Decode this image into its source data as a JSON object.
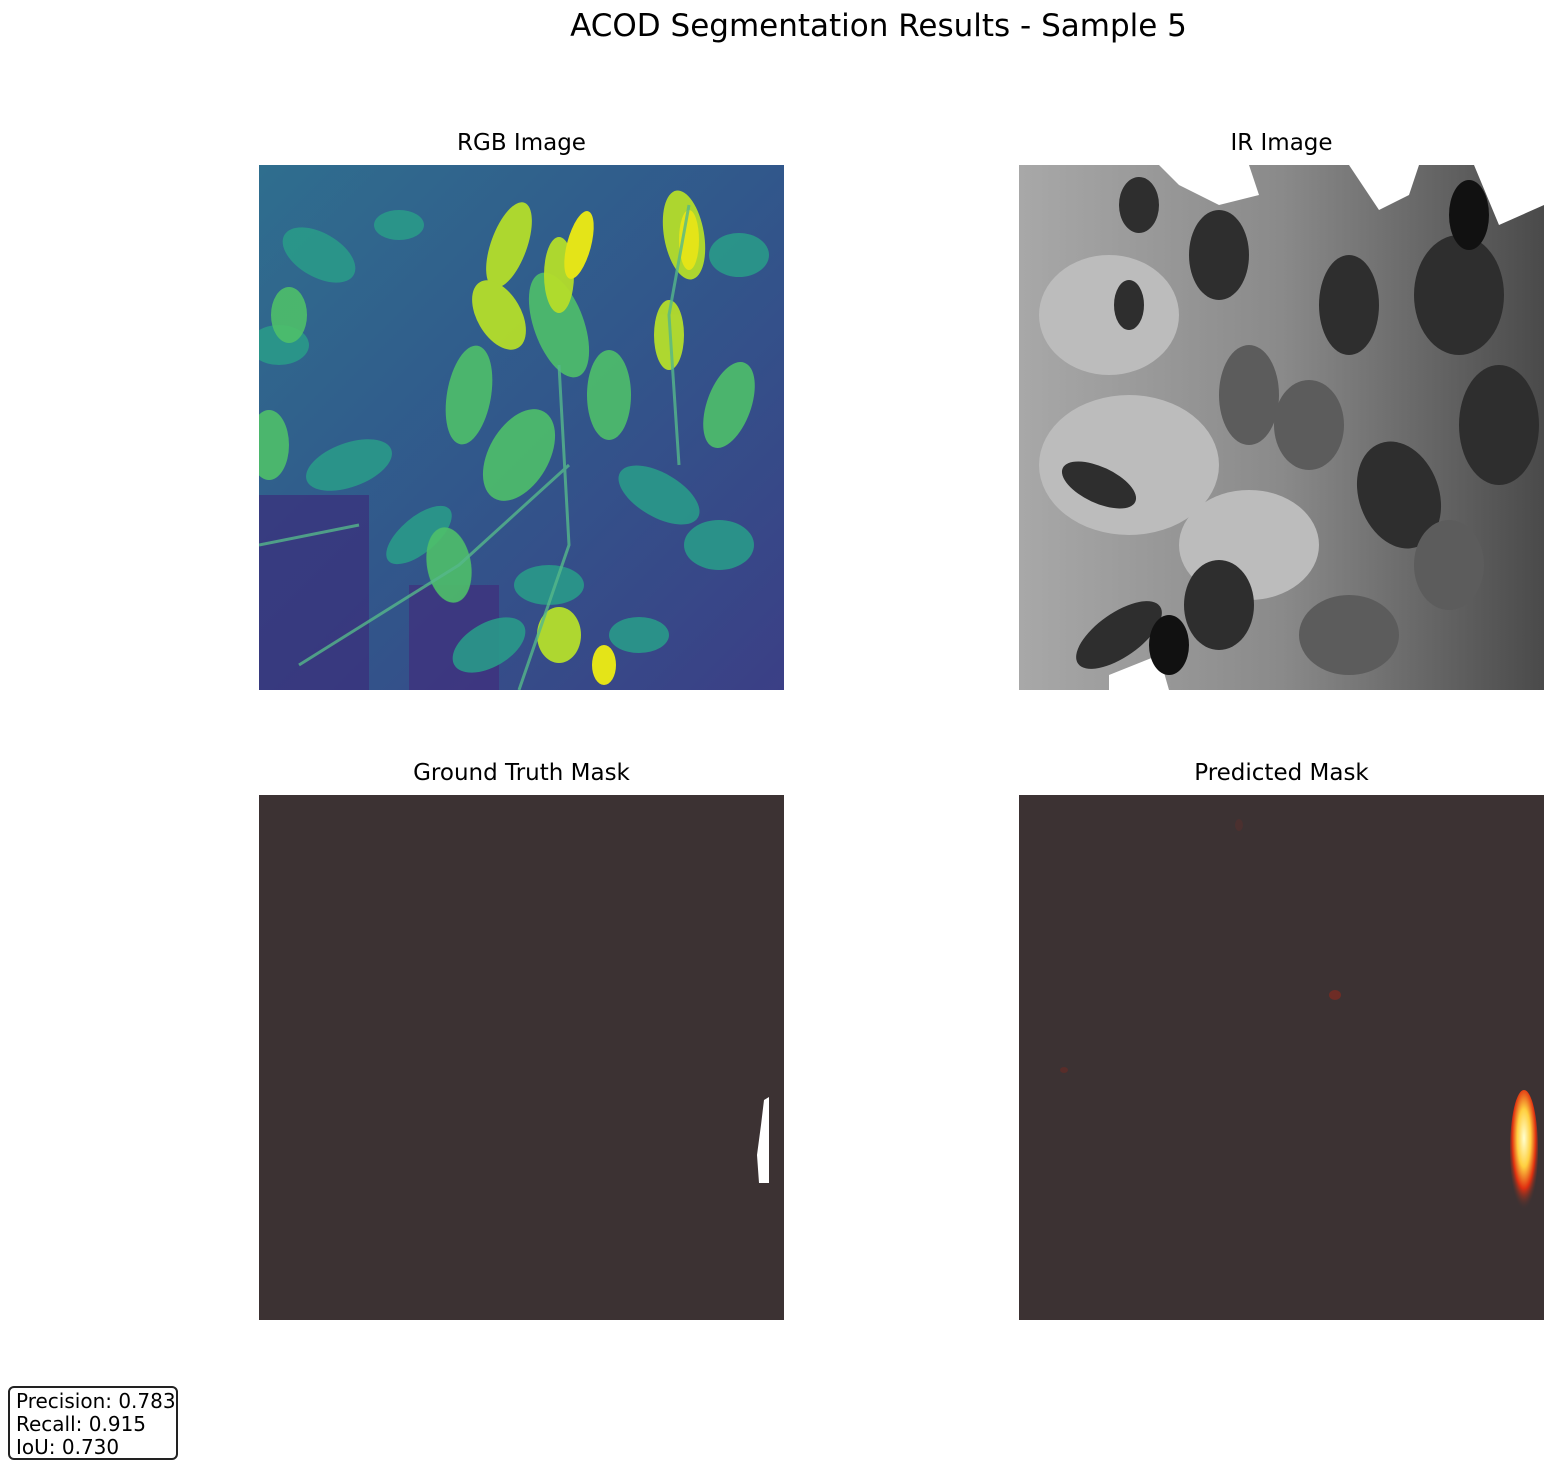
{
  "figure": {
    "title": "ACOD Segmentation Results - Sample 5"
  },
  "panels": {
    "rgb": {
      "title": "RGB Image",
      "colormap": "viridis"
    },
    "ir": {
      "title": "IR Image",
      "colormap": "gray"
    },
    "gt": {
      "title": "Ground Truth Mask",
      "colormap": "binary"
    },
    "pred": {
      "title": "Predicted Mask",
      "colormap": "hot"
    }
  },
  "metrics": {
    "precision": "Precision: 0.783",
    "recall": "Recall: 0.915",
    "iou": "IoU: 0.730"
  },
  "colors": {
    "mask_background": "#3c3233",
    "mask_foreground": "#ffffff",
    "viridis_dark": "#3b2f7e",
    "viridis_mid": "#21918c",
    "viridis_bright": "#d8e219"
  }
}
